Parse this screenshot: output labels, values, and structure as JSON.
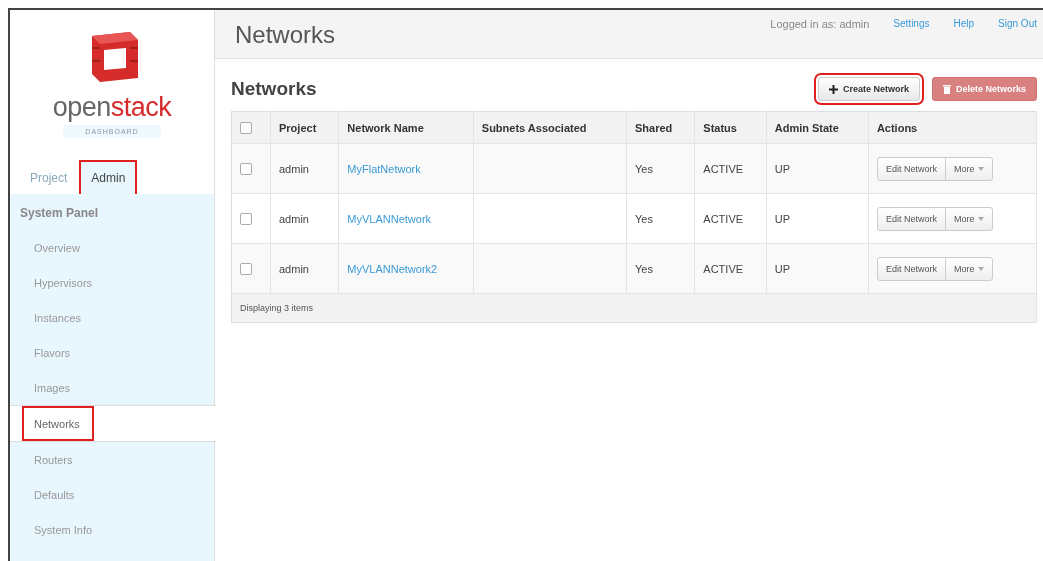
{
  "logo": {
    "word_start": "open",
    "word_end": "stack",
    "subtitle": "DASHBOARD"
  },
  "sidebar": {
    "tabs": [
      {
        "label": "Project",
        "selected": false,
        "highlighted": false
      },
      {
        "label": "Admin",
        "selected": true,
        "highlighted": true
      }
    ],
    "panel_title": "System Panel",
    "items": [
      {
        "label": "Overview",
        "selected": false,
        "highlighted": false
      },
      {
        "label": "Hypervisors",
        "selected": false,
        "highlighted": false
      },
      {
        "label": "Instances",
        "selected": false,
        "highlighted": false
      },
      {
        "label": "Flavors",
        "selected": false,
        "highlighted": false
      },
      {
        "label": "Images",
        "selected": false,
        "highlighted": false
      },
      {
        "label": "Networks",
        "selected": true,
        "highlighted": true
      },
      {
        "label": "Routers",
        "selected": false,
        "highlighted": false
      },
      {
        "label": "Defaults",
        "selected": false,
        "highlighted": false
      },
      {
        "label": "System Info",
        "selected": false,
        "highlighted": false
      }
    ]
  },
  "header": {
    "title": "Networks",
    "user_text": "Logged in as: admin",
    "links": [
      "Settings",
      "Help",
      "Sign Out"
    ]
  },
  "content": {
    "title": "Networks",
    "buttons": [
      {
        "kind": "create",
        "label": "Create Network",
        "highlighted": true
      },
      {
        "kind": "delete",
        "label": "Delete Networks",
        "highlighted": false
      }
    ],
    "table": {
      "select_all_checked": false,
      "columns": [
        "Project",
        "Network Name",
        "Subnets Associated",
        "Shared",
        "Status",
        "Admin State",
        "Actions"
      ],
      "rows": [
        {
          "checked": false,
          "project": "admin",
          "name": "MyFlatNetwork",
          "shared": "Yes",
          "status": "ACTIVE",
          "admin_state": "UP",
          "action": "Edit Network",
          "more": "More"
        },
        {
          "checked": false,
          "project": "admin",
          "name": "MyVLANNetwork",
          "shared": "Yes",
          "status": "ACTIVE",
          "admin_state": "UP",
          "action": "Edit Network",
          "more": "More"
        },
        {
          "checked": false,
          "project": "admin",
          "name": "MyVLANNetwork2",
          "shared": "Yes",
          "status": "ACTIVE",
          "admin_state": "UP",
          "action": "Edit Network",
          "more": "More"
        }
      ],
      "footer": "Displaying 3 items"
    }
  }
}
